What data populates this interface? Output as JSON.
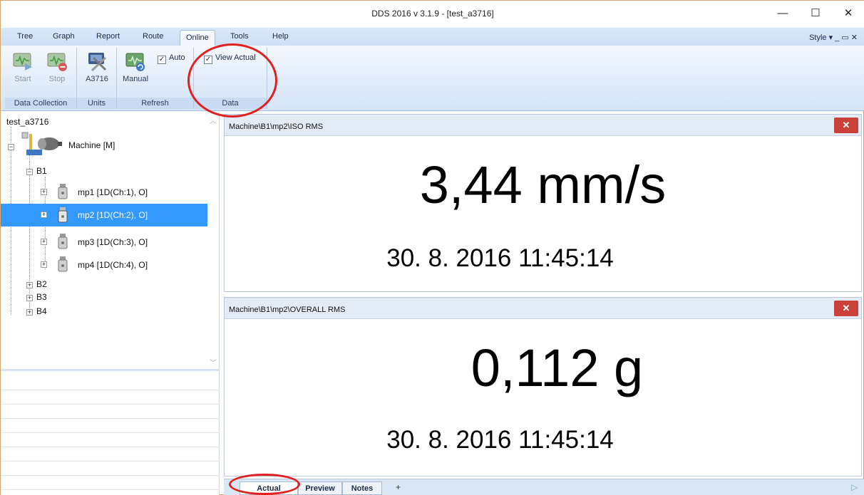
{
  "window": {
    "title": "DDS 2016 v 3.1.9 - [test_a3716]",
    "minimize": "—",
    "maximize": "☐",
    "close": "✕"
  },
  "ribbon_tabs": [
    {
      "label": "Tree"
    },
    {
      "label": "Graph"
    },
    {
      "label": "Report"
    },
    {
      "label": "Route"
    },
    {
      "label": "Online"
    },
    {
      "label": "Tools"
    },
    {
      "label": "Help"
    }
  ],
  "style_menu": "Style  ▾  _  ▭  ✕",
  "ribbon": {
    "data_collection": {
      "label": "Data Collection",
      "start": "Start",
      "stop": "Stop"
    },
    "units": {
      "label": "Units",
      "a3716": "A3716"
    },
    "refresh": {
      "label": "Refresh",
      "manual": "Manual",
      "auto": "Auto",
      "auto_checked": "✓"
    },
    "data": {
      "label": "Data",
      "view_actual": "View Actual",
      "view_actual_checked": "✓"
    }
  },
  "tree": {
    "root": "test_a3716",
    "machine": "Machine [M]",
    "b1": "B1",
    "mp1": "mp1 [1D(Ch:1), O]",
    "mp2": "mp2 [1D(Ch:2), O]",
    "mp3": "mp3 [1D(Ch:3), O]",
    "mp4": "mp4 [1D(Ch:4), O]",
    "b2": "B2",
    "b3": "B3",
    "b4": "B4",
    "scroll_up": "︿",
    "scroll_down": "﹀"
  },
  "panels": {
    "iso": {
      "path": "Machine\\B1\\mp2\\ISO RMS",
      "value": "3,44 mm/s",
      "timestamp": "30. 8. 2016 11:45:14",
      "close": "✕"
    },
    "overall": {
      "path": "Machine\\B1\\mp2\\OVERALL RMS",
      "value": "0,112 g",
      "timestamp": "30. 8. 2016 11:45:14",
      "close": "✕"
    }
  },
  "bottom_tabs": {
    "actual": "Actual",
    "preview": "Preview",
    "notes": "Notes",
    "add": "+",
    "arrow": "▷"
  }
}
